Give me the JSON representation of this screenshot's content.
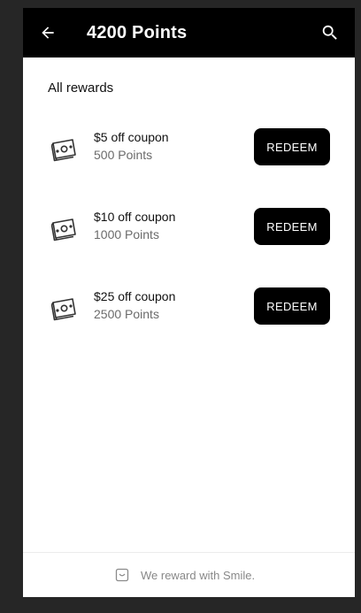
{
  "header": {
    "title": "4200 Points"
  },
  "rewards": {
    "section_title": "All rewards",
    "items": [
      {
        "name": "$5 off coupon",
        "points": "500 Points",
        "button": "REDEEM"
      },
      {
        "name": "$10 off coupon",
        "points": "1000 Points",
        "button": "REDEEM"
      },
      {
        "name": "$25 off coupon",
        "points": "2500 Points",
        "button": "REDEEM"
      }
    ]
  },
  "footer": {
    "text": "We reward with Smile."
  },
  "icons": {
    "back": "arrow-left-icon",
    "search": "search-icon",
    "reward": "cash-icon",
    "footer": "smile-bag-icon"
  },
  "colors": {
    "appbar": "#000000",
    "button": "#000000",
    "button_text": "#ffffff"
  }
}
